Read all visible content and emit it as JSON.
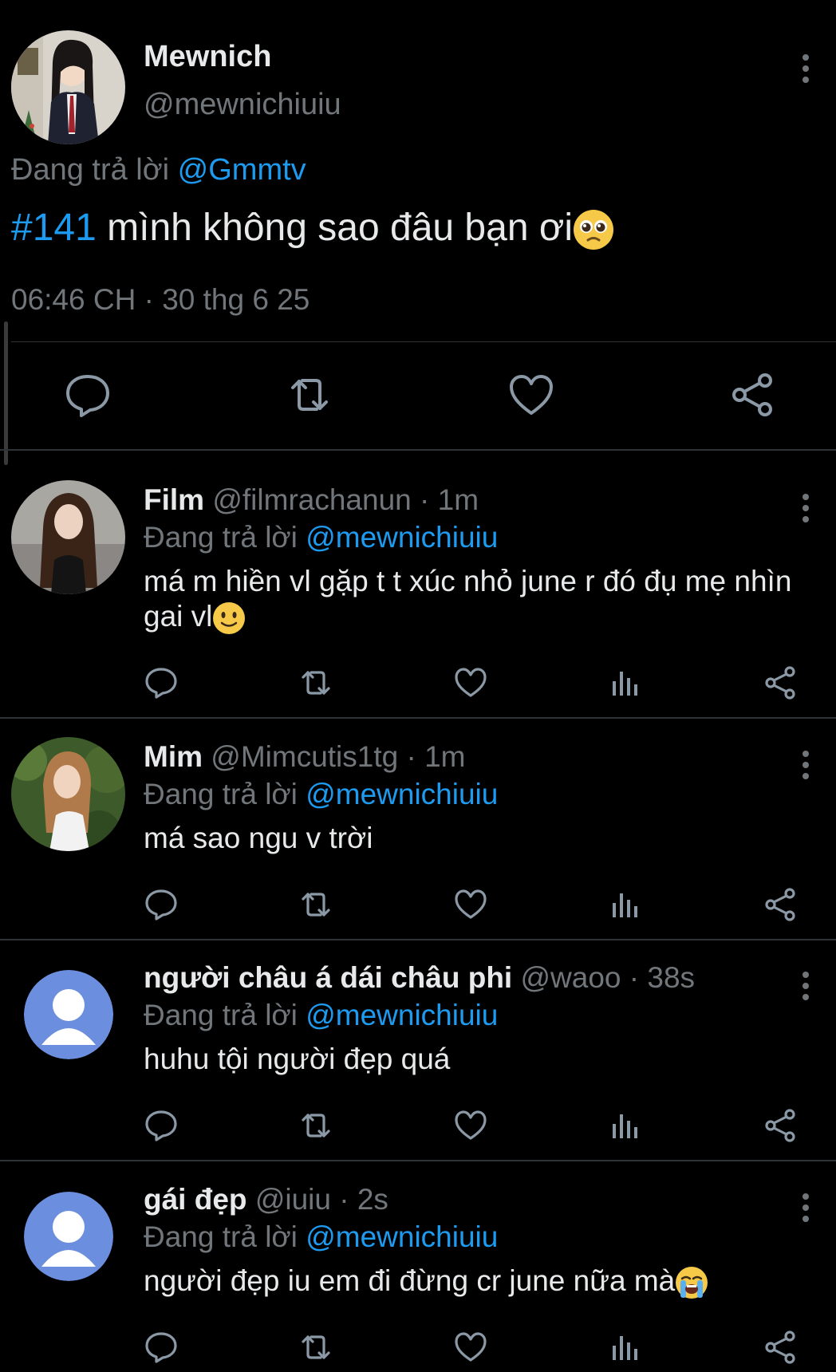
{
  "main_tweet": {
    "name": "Mewnich",
    "handle": "@mewnichiuiu",
    "replying_prefix": "Đang trả lời",
    "replying_to": "@Gmmtv",
    "hashtag": "#141",
    "text": " mình không sao đâu bạn ơi",
    "emoji": "pleading-face",
    "timestamp": "06:46 CH · 30 thg 6 25"
  },
  "replies": [
    {
      "name": "Film",
      "meta": "@filmrachanun · 1m",
      "replying_prefix": "Đang trả lời",
      "replying_to": "@mewnichiuiu",
      "text": "má m hiền vl gặp t t xúc nhỏ june r đó đụ mẹ nhìn gai vl",
      "emoji": "slightly-smiling-face"
    },
    {
      "name": "Mim",
      "meta": "@Mimcutis1tg · 1m",
      "replying_prefix": "Đang trả lời",
      "replying_to": "@mewnichiuiu",
      "text": "má sao ngu v trời",
      "emoji": ""
    },
    {
      "name": "người châu á dái châu phi",
      "meta": "@waoo · 38s",
      "replying_prefix": "Đang trả lời",
      "replying_to": "@mewnichiuiu",
      "text": "huhu tội người đẹp quá",
      "emoji": ""
    },
    {
      "name": "gái đẹp",
      "meta": "@iuiu · 2s",
      "replying_prefix": "Đang trả lời",
      "replying_to": "@mewnichiuiu",
      "text": "người đẹp iu em đi đừng cr june nữa mà",
      "emoji": "loudly-crying-face"
    }
  ],
  "colors": {
    "background": "#000000",
    "text": "#e7e9ea",
    "secondary": "#71767b",
    "accent": "#1d9bf0",
    "divider": "#2f3336",
    "default_avatar": "#6b8fde"
  },
  "icons": [
    "more-vertical-icon",
    "reply-icon",
    "retweet-icon",
    "like-icon",
    "views-icon",
    "share-icon"
  ]
}
